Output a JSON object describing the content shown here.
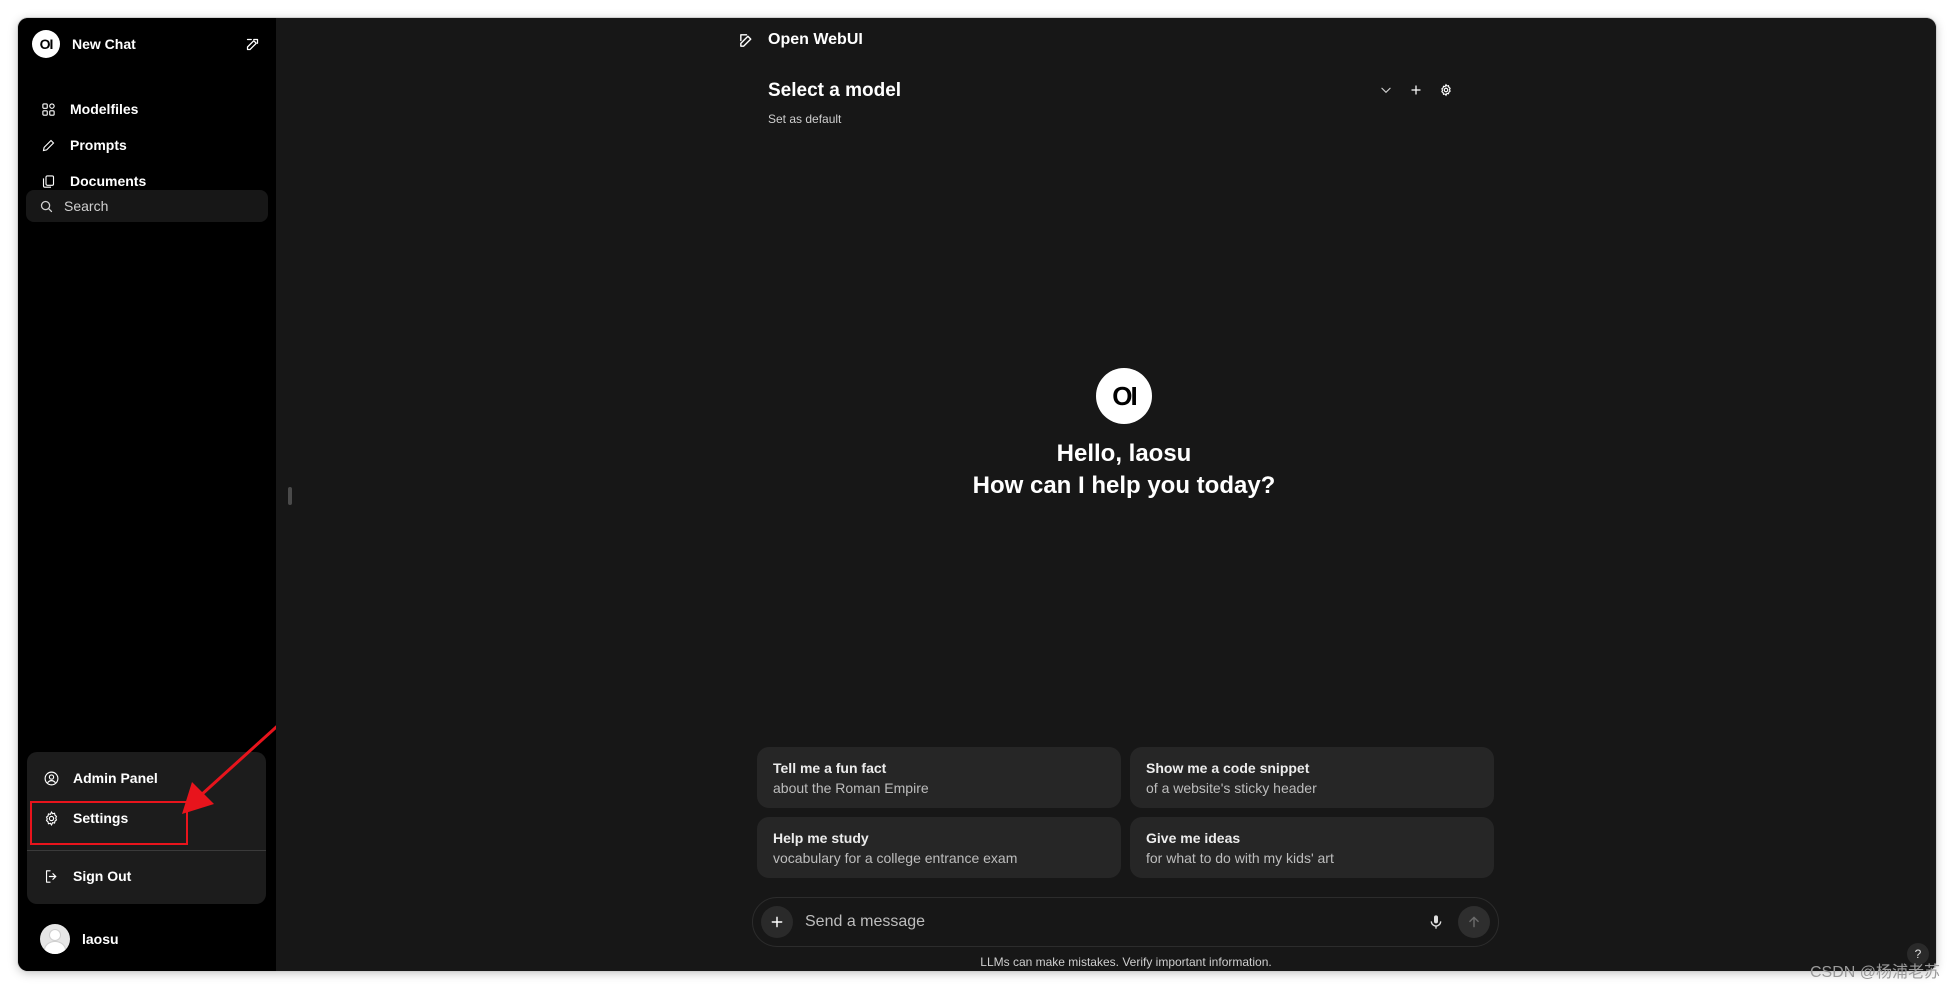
{
  "sidebar": {
    "new_chat_label": "New Chat",
    "logo_text": "OI",
    "nav": [
      {
        "label": "Modelfiles",
        "icon": "modelfiles-icon"
      },
      {
        "label": "Prompts",
        "icon": "pencil-icon"
      },
      {
        "label": "Documents",
        "icon": "documents-icon"
      }
    ],
    "search_placeholder": "Search",
    "account_menu": {
      "admin_panel": "Admin Panel",
      "settings": "Settings",
      "sign_out": "Sign Out"
    },
    "user_name": "laosu"
  },
  "header": {
    "title": "Open WebUI",
    "model_selector": "Select a model",
    "set_default": "Set as default"
  },
  "hero": {
    "logo_text": "OI",
    "greeting_line1": "Hello, laosu",
    "greeting_line2": "How can I help you today?"
  },
  "suggestions": [
    {
      "title": "Tell me a fun fact",
      "subtitle": "about the Roman Empire"
    },
    {
      "title": "Show me a code snippet",
      "subtitle": "of a website's sticky header"
    },
    {
      "title": "Help me study",
      "subtitle": "vocabulary for a college entrance exam"
    },
    {
      "title": "Give me ideas",
      "subtitle": "for what to do with my kids' art"
    }
  ],
  "composer": {
    "placeholder": "Send a message",
    "disclaimer": "LLMs can make mistakes. Verify important information."
  },
  "help_label": "?",
  "watermark": "CSDN @杨浦老苏",
  "colors": {
    "sidebar_bg": "#000000",
    "main_bg": "#171717",
    "card_bg": "#262626",
    "highlight": "#e8141c"
  }
}
